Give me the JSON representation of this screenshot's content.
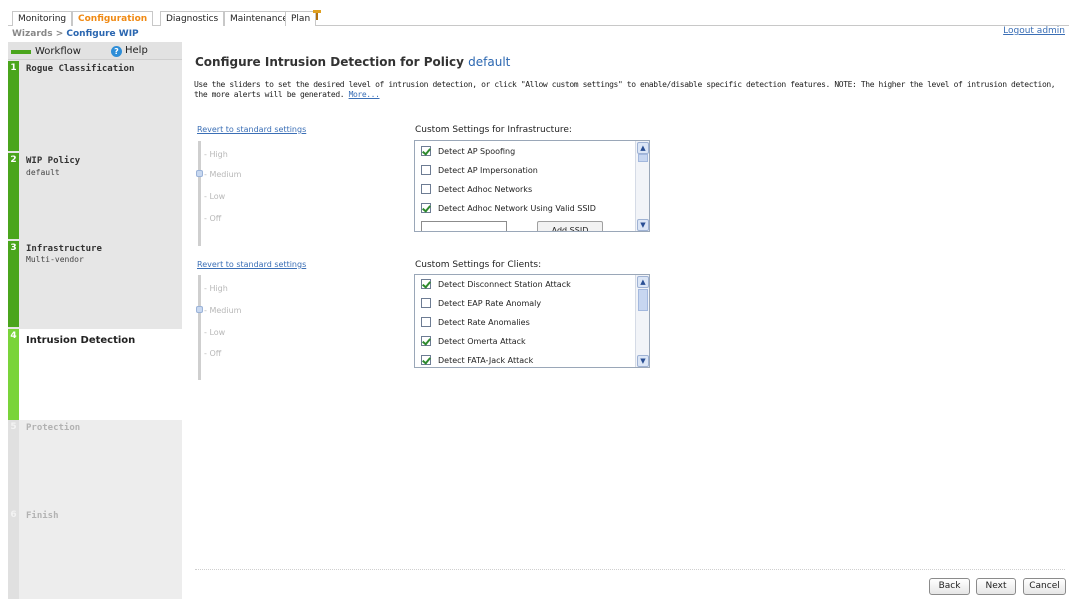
{
  "nav": {
    "tabs": [
      {
        "label": "Monitoring"
      },
      {
        "label": "Configuration"
      },
      {
        "label": "Diagnostics"
      },
      {
        "label": "Maintenance"
      },
      {
        "label": "Plan"
      }
    ],
    "active_tab": "Configuration",
    "logout": "Logout admin"
  },
  "breadcrumb": {
    "root": "Wizards",
    "sep": ">",
    "current": "Configure WIP"
  },
  "sidebar": {
    "workflow": "Workflow",
    "help": "Help",
    "steps": [
      {
        "num": "1",
        "title": "Rogue Classification",
        "sub": "",
        "state": "done"
      },
      {
        "num": "2",
        "title": "WIP Policy",
        "sub": "default",
        "state": "done"
      },
      {
        "num": "3",
        "title": "Infrastructure",
        "sub": "Multi-vendor",
        "state": "done"
      },
      {
        "num": "4",
        "title": "Intrusion Detection",
        "sub": "",
        "state": "current"
      },
      {
        "num": "5",
        "title": "Protection",
        "sub": "",
        "state": "future"
      },
      {
        "num": "6",
        "title": "Finish",
        "sub": "",
        "state": "future"
      }
    ]
  },
  "main": {
    "title": "Configure Intrusion Detection for Policy",
    "policy": "default",
    "intro": "Use the sliders to set the desired level of intrusion detection, or click \"Allow custom settings\" to enable/disable specific detection features. NOTE: The higher the level of intrusion detection, the more alerts will be generated.",
    "more_link": "More...",
    "infra": {
      "revert": "Revert to standard settings",
      "levels": [
        "High",
        "Medium",
        "Low",
        "Off"
      ],
      "selected_level": "Medium",
      "custom_title": "Custom Settings for Infrastructure:",
      "items": [
        {
          "label": "Detect AP Spoofing",
          "checked": true
        },
        {
          "label": "Detect AP Impersonation",
          "checked": false
        },
        {
          "label": "Detect Adhoc Networks",
          "checked": false
        },
        {
          "label": "Detect Adhoc Network Using Valid SSID",
          "checked": true
        }
      ],
      "add_ssid": "Add SSID",
      "ssid_value": ""
    },
    "clients": {
      "revert": "Revert to standard settings",
      "levels": [
        "High",
        "Medium",
        "Low",
        "Off"
      ],
      "selected_level": "Medium",
      "custom_title": "Custom Settings for Clients:",
      "items": [
        {
          "label": "Detect Disconnect Station Attack",
          "checked": true
        },
        {
          "label": "Detect EAP Rate Anomaly",
          "checked": false
        },
        {
          "label": "Detect Rate Anomalies",
          "checked": false
        },
        {
          "label": "Detect Omerta Attack",
          "checked": true
        },
        {
          "label": "Detect FATA-Jack Attack",
          "checked": true
        }
      ]
    }
  },
  "footer": {
    "back": "Back",
    "next": "Next",
    "cancel": "Cancel"
  },
  "colors": {
    "accent_orange": "#f08a14",
    "link_blue": "#3b6fb6",
    "step_green": "#4aa51c",
    "current_green": "#7ad43a"
  }
}
